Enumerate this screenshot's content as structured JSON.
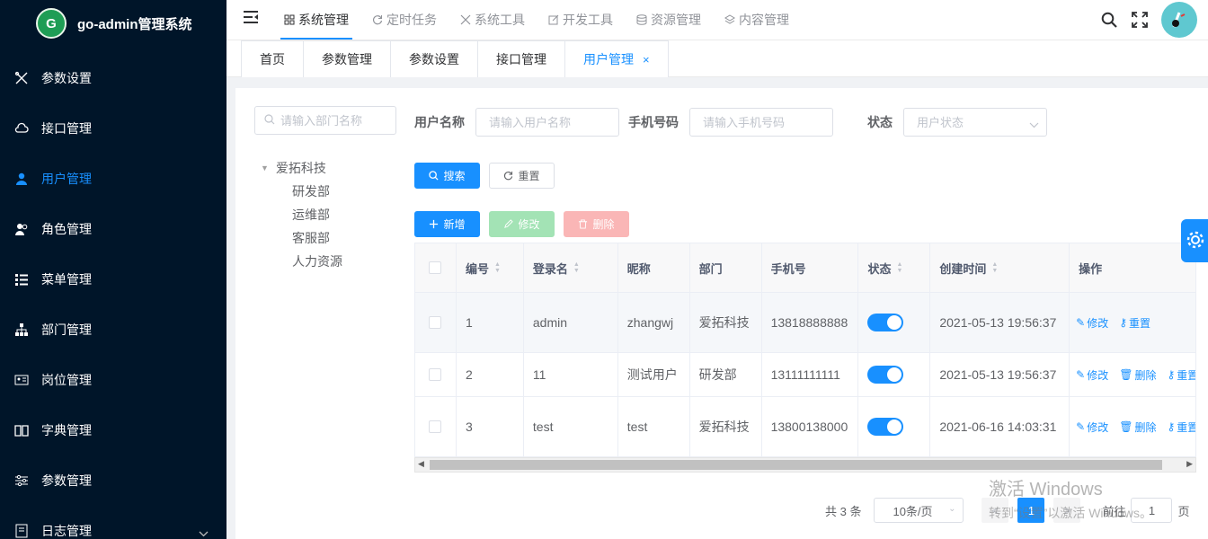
{
  "app": {
    "title": "go-admin管理系统",
    "logo_letter": "G"
  },
  "sidebar": {
    "items": [
      {
        "label": "参数设置",
        "icon": "tools-icon"
      },
      {
        "label": "接口管理",
        "icon": "cloud-icon"
      },
      {
        "label": "用户管理",
        "icon": "user-icon",
        "active": true
      },
      {
        "label": "角色管理",
        "icon": "users-icon"
      },
      {
        "label": "菜单管理",
        "icon": "list-icon"
      },
      {
        "label": "部门管理",
        "icon": "tree-icon"
      },
      {
        "label": "岗位管理",
        "icon": "id-card-icon"
      },
      {
        "label": "字典管理",
        "icon": "book-icon"
      },
      {
        "label": "参数管理",
        "icon": "sliders-icon"
      },
      {
        "label": "日志管理",
        "icon": "log-icon"
      }
    ]
  },
  "header": {
    "nav": [
      {
        "label": "系统管理",
        "active": true
      },
      {
        "label": "定时任务"
      },
      {
        "label": "系统工具"
      },
      {
        "label": "开发工具"
      },
      {
        "label": "资源管理"
      },
      {
        "label": "内容管理"
      }
    ]
  },
  "tabs": [
    {
      "label": "首页"
    },
    {
      "label": "参数管理"
    },
    {
      "label": "参数设置"
    },
    {
      "label": "接口管理"
    },
    {
      "label": "用户管理",
      "active": true,
      "close": "×"
    }
  ],
  "dept": {
    "search_placeholder": "请输入部门名称",
    "root": "爱拓科技",
    "children": [
      "研发部",
      "运维部",
      "客服部",
      "人力资源"
    ]
  },
  "form": {
    "username_label": "用户名称",
    "username_placeholder": "请输入用户名称",
    "phone_label": "手机号码",
    "phone_placeholder": "请输入手机号码",
    "status_label": "状态",
    "status_placeholder": "用户状态",
    "search": "搜索",
    "reset": "重置"
  },
  "toolbar": {
    "add": "新增",
    "edit": "修改",
    "delete": "删除"
  },
  "table": {
    "columns": [
      "编号",
      "登录名",
      "昵称",
      "部门",
      "手机号",
      "状态",
      "创建时间",
      "操作"
    ],
    "rows": [
      {
        "id": "1",
        "login": "admin",
        "nick": "zhangwj",
        "dept": "爱拓科技",
        "phone": "13818888888",
        "enabled": true,
        "created": "2021-05-13 19:56:37",
        "ops": [
          "修改",
          "重置"
        ]
      },
      {
        "id": "2",
        "login": "11",
        "nick": "测试用户",
        "dept": "研发部",
        "phone": "13111111111",
        "enabled": true,
        "created": "2021-05-13 19:56:37",
        "ops": [
          "修改",
          "删除",
          "重置"
        ]
      },
      {
        "id": "3",
        "login": "test",
        "nick": "test",
        "dept": "爱拓科技",
        "phone": "13800138000",
        "enabled": true,
        "created": "2021-06-16 14:03:31",
        "ops": [
          "修改",
          "删除",
          "重置"
        ]
      }
    ]
  },
  "pager": {
    "total": "共 3 条",
    "page_size": "10条/页",
    "prev": "<",
    "current": "1",
    "next": ">",
    "goto": "前往",
    "goto_value": "1",
    "page_suffix": "页"
  },
  "watermark": {
    "line1": "激活 Windows",
    "line2": "转到“设置”以激活 Windows。"
  },
  "colors": {
    "primary": "#1890ff",
    "sidebar_bg": "#001529",
    "success_disabled": "#a3e3b5",
    "danger_disabled": "#fab6b6"
  }
}
